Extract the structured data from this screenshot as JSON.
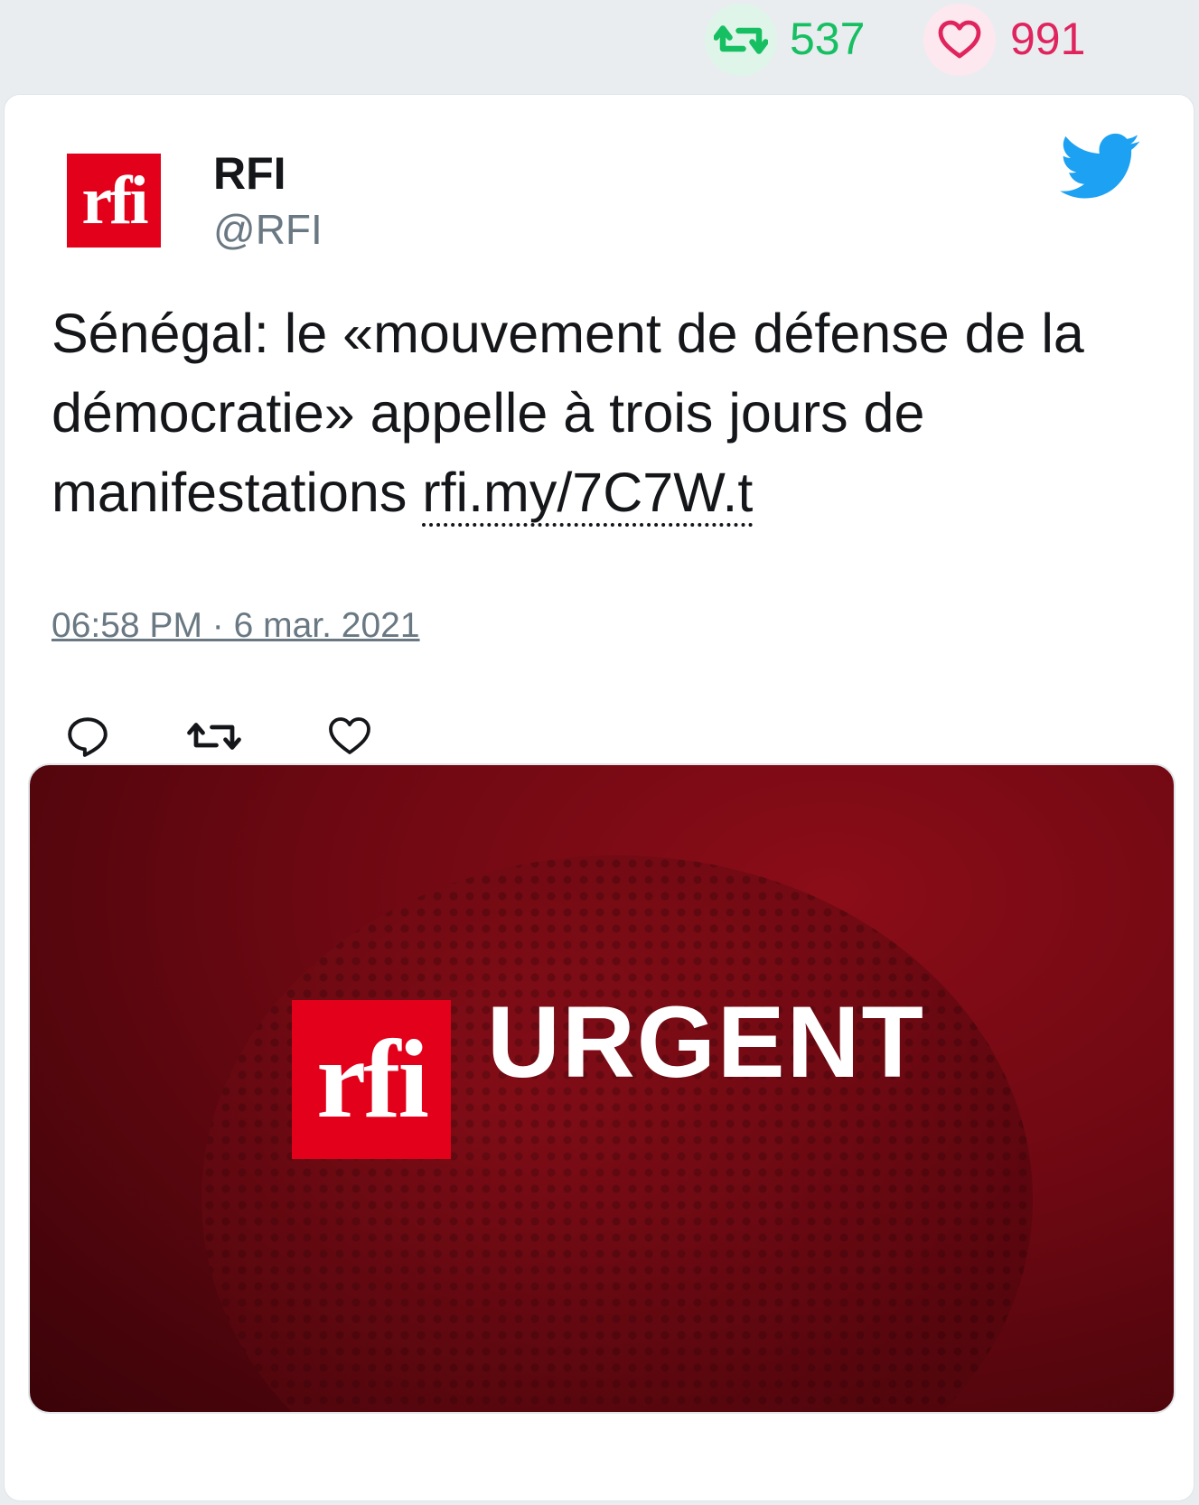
{
  "stats": {
    "retweet_icon": "retweet-icon",
    "retweet_count": "537",
    "retweet_color": "#17bf63",
    "like_icon": "heart-icon",
    "like_count": "991",
    "like_color": "#e0245e"
  },
  "tweet": {
    "author_name": "RFI",
    "author_handle": "@RFI",
    "avatar_text": "rfi",
    "platform_icon": "twitter-bird-icon",
    "text": "Sénégal: le «mouvement de défense de la démocratie» appelle à trois jours de manifestations ",
    "link_text": "rfi.my/7C7W.t",
    "timestamp": "06:58 PM · 6 mar. 2021",
    "actions": [
      {
        "icon": "reply-icon"
      },
      {
        "icon": "retweet-icon"
      },
      {
        "icon": "like-icon"
      }
    ]
  },
  "media": {
    "logo_text": "rfi",
    "headline": "URGENT",
    "brand_color": "#e2001a"
  }
}
